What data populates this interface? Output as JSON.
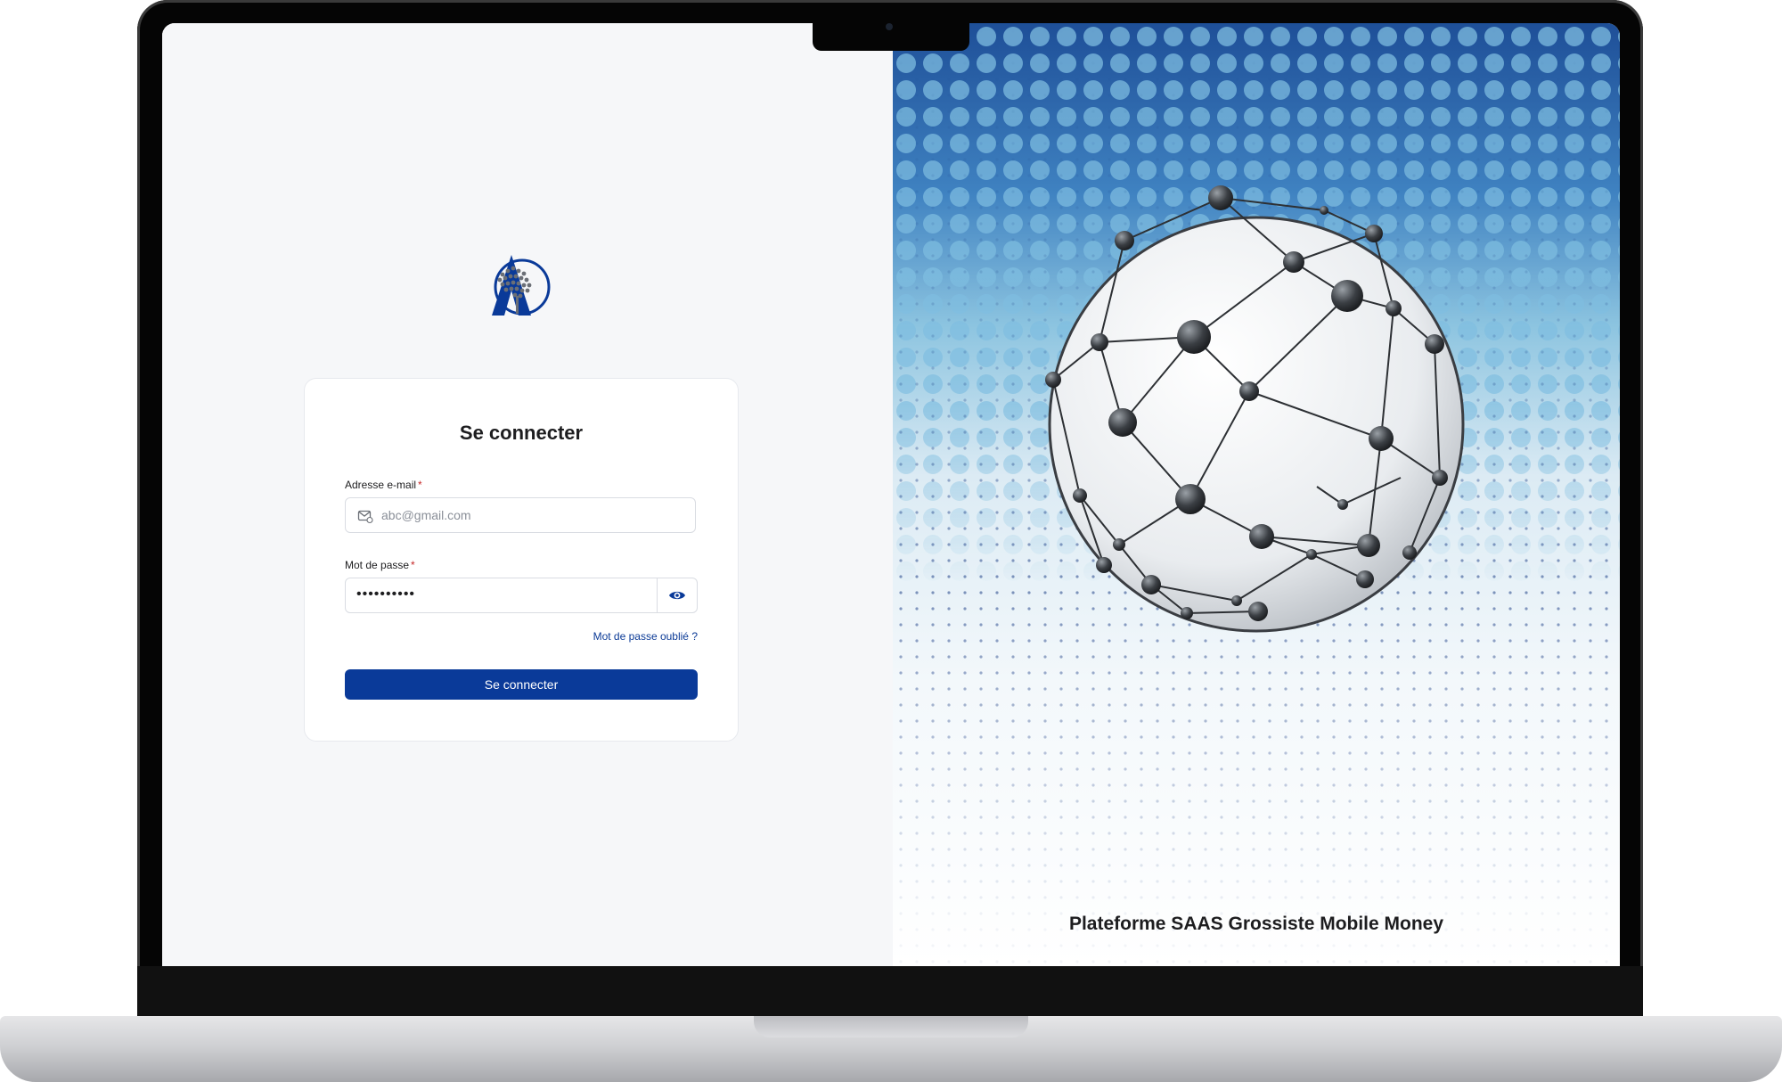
{
  "login": {
    "title": "Se connecter",
    "email_label": "Adresse e-mail",
    "required_mark": "*",
    "email_placeholder": "abc@gmail.com",
    "password_label": "Mot de passe",
    "password_value": "••••••••••",
    "forgot_link": "Mot de passe oublié ?",
    "submit_label": "Se connecter"
  },
  "hero": {
    "tagline": "Plateforme SAAS Grossiste Mobile Money"
  },
  "icons": {
    "logo": "tree-a-logo",
    "email": "mail-icon",
    "password_toggle": "eye-icon",
    "illustration": "network-globe"
  },
  "colors": {
    "primary": "#0a3a99",
    "link": "#0b3a96",
    "required": "#c62828",
    "left_background": "#f6f7f9"
  }
}
